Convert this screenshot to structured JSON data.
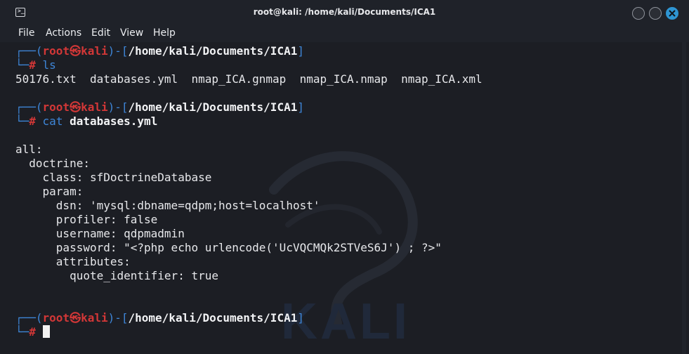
{
  "window": {
    "title": "root@kali: /home/kali/Documents/ICA1",
    "accent": "#2e95d3"
  },
  "menu": [
    "File",
    "Actions",
    "Edit",
    "View",
    "Help"
  ],
  "prompt": {
    "corner_top": "┌──(",
    "user": "root㉿kali",
    "mid": ")-[",
    "path": "/home/kali/Documents/ICA1",
    "end": "]",
    "corner_bottom": "└─",
    "hash": "#"
  },
  "terminal": {
    "cmd1": "ls",
    "ls_output": "50176.txt  databases.yml  nmap_ICA.gnmap  nmap_ICA.nmap  nmap_ICA.xml",
    "cmd2_name": "cat",
    "cmd2_arg": "databases.yml",
    "yaml_lines": [
      "all:",
      "  doctrine:",
      "    class: sfDoctrineDatabase",
      "    param:",
      "      dsn: 'mysql:dbname=qdpm;host=localhost'",
      "      profiler: false",
      "      username: qdpmadmin",
      "      password: \"<?php echo urlencode('UcVQCMQk2STVeS6J') ; ?>\"",
      "      attributes:",
      "        quote_identifier: true"
    ]
  },
  "colors": {
    "background": "#1c1e24",
    "prompt_blue": "#3e86d8",
    "prompt_red": "#d23737",
    "text": "#e7e8eb"
  }
}
